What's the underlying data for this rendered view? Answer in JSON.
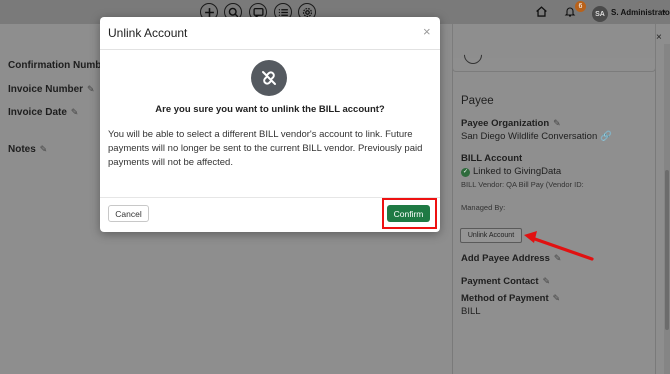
{
  "topbar": {
    "nav_icons": [
      "plus-icon",
      "search-icon",
      "chat-icon",
      "list-icon",
      "settings-icon"
    ],
    "home_icon": "home-icon",
    "bell_icon": "bell-icon",
    "notification_count": "6",
    "avatar_initials": "SA",
    "user_name": "S. Administrator"
  },
  "background": {
    "fields": [
      {
        "label": "Confirmation Number"
      },
      {
        "label": "Invoice Number"
      },
      {
        "label": "Invoice Date"
      },
      {
        "label": "Notes"
      }
    ],
    "close_label": "×"
  },
  "payee": {
    "title": "Payee",
    "organization_label": "Payee Organization",
    "organization_value": "San Diego Wildlife Conversation",
    "bill_account_label": "BILL Account",
    "linked_text": "Linked to GivingData",
    "bill_vendor_text": "BILL Vendor: QA Bill Pay (Vendor ID:",
    "managed_by_label": "Managed By:",
    "unlink_button": "Unlink Account",
    "add_address_label": "Add Payee Address",
    "payment_contact_label": "Payment Contact",
    "method_label": "Method of Payment",
    "method_value": "BILL"
  },
  "modal": {
    "title": "Unlink Account",
    "close": "×",
    "icon": "unlink-icon",
    "question": "Are you sure you want to unlink the BILL account?",
    "body": "You will be able to select a different BILL vendor's account to link. Future payments will no longer be sent to the current BILL vendor. Previously paid payments will not be affected.",
    "cancel_label": "Cancel",
    "confirm_label": "Confirm"
  },
  "colors": {
    "confirm": "#1f7a44",
    "highlight": "#e11111",
    "badge": "#b8621b"
  }
}
